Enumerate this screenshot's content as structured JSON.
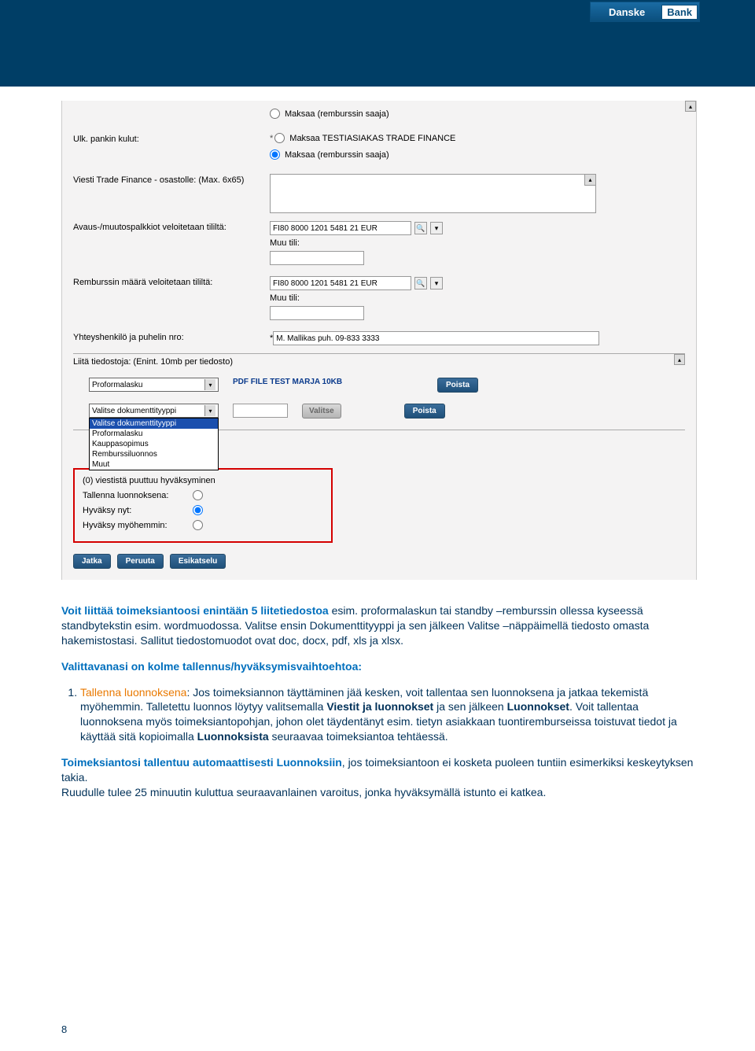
{
  "logo": {
    "left": "Danske",
    "right": "Bank"
  },
  "form": {
    "radio_top": "Maksaa (remburssin saaja)",
    "ulk_label": "Ulk. pankin kulut:",
    "radio_testi": "Maksaa TESTIASIAKAS TRADE FINANCE",
    "radio_saaja2": "Maksaa (remburssin saaja)",
    "viesti_label": "Viesti Trade Finance - osastolle: (Max. 6x65)",
    "avaus_label": "Avaus-/muutospalkkiot veloitetaan tililtä:",
    "account": "FI80 8000 1201 5481 21 EUR",
    "muu_tili_label": "Muu tili:",
    "remburssin_label": "Remburssin määrä veloitetaan tililtä:",
    "yhteys_label": "Yhteyshenkilö ja puhelin nro:",
    "yhteys_value": "M. Mallikas puh. 09-833 3333",
    "attach_header": "Liitä tiedostoja: (Enint. 10mb per tiedosto)",
    "select_value": "Proformalasku",
    "select2_value": "Valitse dokumenttityyppi",
    "filelink": "PDF FILE TEST MARJA 10KB",
    "poista": "Poista",
    "valitse": "Valitse",
    "dropdown": {
      "opt1": "Valitse dokumenttityyppi",
      "opt2": "Proformalasku",
      "opt3": "Kauppasopimus",
      "opt4": "Remburssiluonnos",
      "opt5": "Muut"
    },
    "redbox": {
      "line1": "(0) viestistä puuttuu hyväksyminen",
      "tallenna": "Tallenna luonnoksena:",
      "hyvaksy_nyt": "Hyväksy nyt:",
      "hyvaksy_myoh": "Hyväksy myöhemmin:"
    },
    "btn_jatka": "Jatka",
    "btn_peruuta": "Peruuta",
    "btn_esikatselu": "Esikatselu"
  },
  "body": {
    "p1a": "Voit liittää toimeksiantoosi enintään 5 liitetiedostoa",
    "p1b": " esim. proformalaskun tai standby –remburssin ollessa kyseessä standbytekstin esim. wordmuodossa. Valitse ensin Dokumenttityyppi ja sen jälkeen Valitse –näppäimellä tiedosto omasta hakemistostasi. Sallitut tiedostomuodot ovat doc, docx, pdf, xls ja xlsx.",
    "p2": "Valittavanasi on kolme tallennus/hyväksymisvaihtoehtoa:",
    "li1_lead": "Tallenna luonnoksena",
    "li1_rest": ": Jos toimeksiannon täyttäminen jää kesken, voit tallentaa sen luonnoksena ja jatkaa tekemistä myöhemmin. Talletettu luonnos löytyy valitsemalla ",
    "li1_bold1": "Viestit ja luonnokset",
    "li1_mid": " ja sen jälkeen ",
    "li1_bold2": "Luonnokset",
    "li1_after": ". Voit tallentaa luonnoksena myös toimeksiantopohjan, johon olet täydentänyt esim. tietyn asiakkaan tuontiremburseissa toistuvat tiedot ja käyttää sitä kopioimalla ",
    "li1_bold3": "Luonnoksista",
    "li1_end": " seuraavaa toimeksiantoa tehtäessä.",
    "p3_lead": "Toimeksiantosi tallentuu automaattisesti Luonnoksiin",
    "p3_rest": ", jos toimeksiantoon ei kosketa puoleen tuntiin esimerkiksi keskeytyksen takia.",
    "p3_line2": "Ruudulle tulee 25 minuutin kuluttua seuraavanlainen varoitus, jonka hyväksymällä istunto ei katkea."
  },
  "pagenum": "8"
}
